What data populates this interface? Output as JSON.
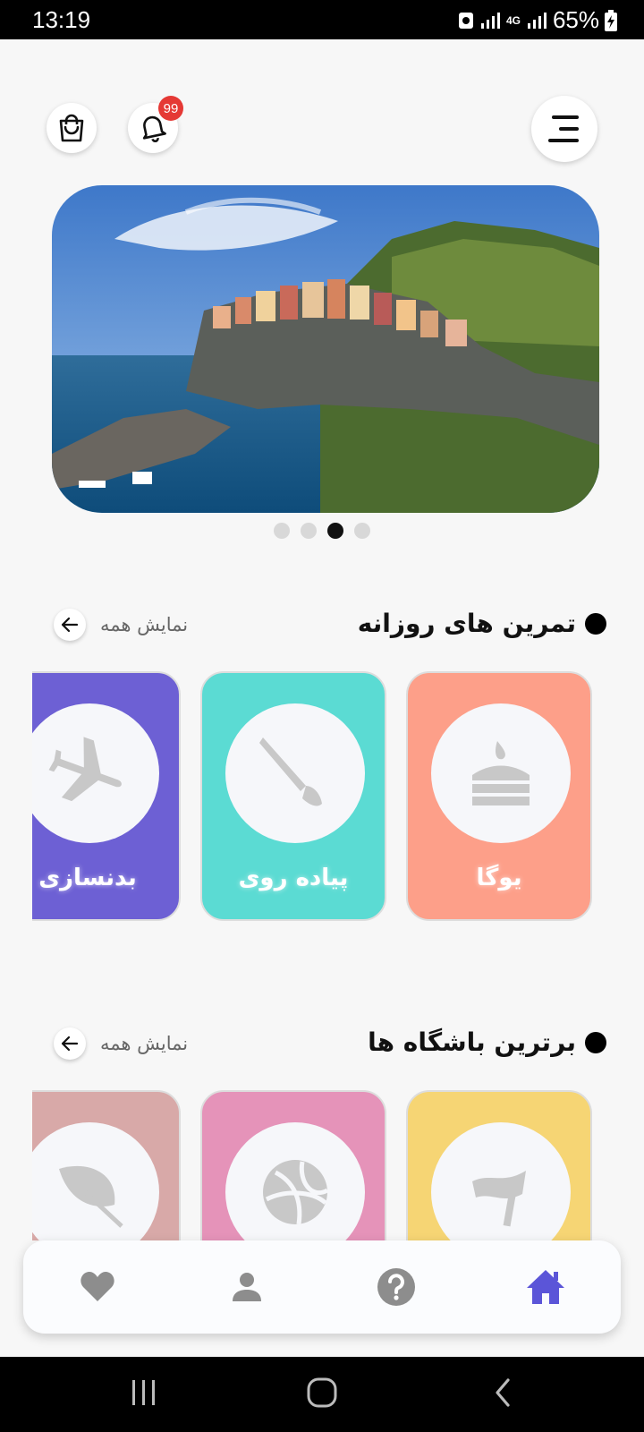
{
  "status": {
    "time": "13:19",
    "battery": "65%",
    "network": "4G"
  },
  "header": {
    "notification_badge": "99",
    "icons": [
      "menu-icon",
      "bell-icon",
      "shopping-bag-icon"
    ]
  },
  "banner": {
    "slides_count": 4,
    "active_index": 2
  },
  "daily_exercises": {
    "title": "تمرین های روزانه",
    "see_all": "نمایش همه",
    "cards": [
      {
        "label": "یوگا",
        "icon": "cake-icon",
        "color": "#fd9f89"
      },
      {
        "label": "پیاده روی",
        "icon": "paint-brush-icon",
        "color": "#5bdbd3"
      },
      {
        "label": "بدنسازی",
        "icon": "airplane-icon",
        "color": "#6d60d4"
      }
    ]
  },
  "top_clubs": {
    "title": "برترین باشگاه ها",
    "see_all": "نمایش همه",
    "cards": [
      {
        "icon": "flag-icon",
        "color": "#f6d574"
      },
      {
        "icon": "volleyball-icon",
        "color": "#e593b9"
      },
      {
        "icon": "leaf-icon",
        "color": "#d8a9a8"
      }
    ]
  },
  "bottom_nav": {
    "items": [
      "home-icon",
      "help-icon",
      "profile-icon",
      "favorites-icon"
    ],
    "active": "home-icon",
    "active_color": "#5b55d8",
    "inactive_color": "#8d8d8d"
  }
}
